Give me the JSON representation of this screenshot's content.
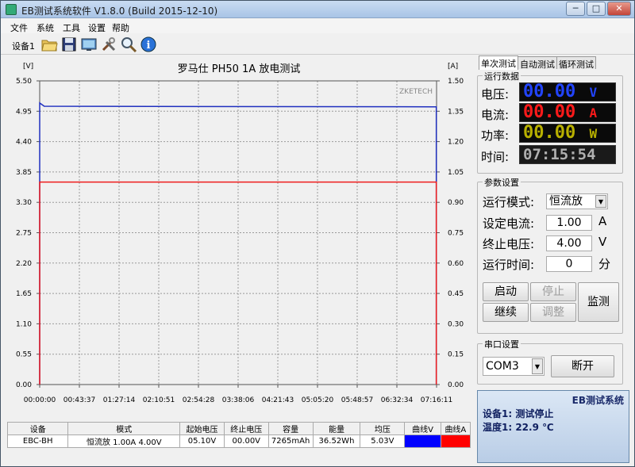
{
  "window": {
    "title": "EB测试系统软件 V1.8.0 (Build 2015-12-10)",
    "minimize": "─",
    "restore": "□",
    "close": "✕"
  },
  "menu": [
    "文件",
    "系统",
    "工具",
    "设置",
    "帮助"
  ],
  "toolbar": {
    "device_label": "设备1",
    "icons": [
      "folder-icon",
      "save-icon",
      "monitor-icon",
      "tools-icon",
      "zoom-icon",
      "info-icon"
    ]
  },
  "chart_data": {
    "type": "line",
    "title": "罗马仕 PH50 1A 放电测试",
    "watermark": "ZKETECH",
    "left_unit": "[V]",
    "right_unit": "[A]",
    "y_left_ticks": [
      "5.50",
      "4.95",
      "4.40",
      "3.85",
      "3.30",
      "2.75",
      "2.20",
      "1.65",
      "1.10",
      "0.55",
      "0.00"
    ],
    "y_right_ticks": [
      "1.50",
      "1.35",
      "1.20",
      "1.05",
      "0.90",
      "0.75",
      "0.60",
      "0.45",
      "0.30",
      "0.15",
      "0.00"
    ],
    "x_ticks": [
      "00:00:00",
      "00:43:37",
      "01:27:14",
      "02:10:51",
      "02:54:28",
      "03:38:06",
      "04:21:43",
      "05:05:20",
      "05:48:57",
      "06:32:34",
      "07:16:11"
    ],
    "ylim_left": [
      0,
      5.5
    ],
    "ylim_right": [
      0,
      1.5
    ],
    "xlim_seconds": [
      0,
      26171
    ],
    "end_seconds": 26154,
    "series": [
      {
        "name": "曲线V",
        "color": "#1f2fbf",
        "axis": "left",
        "points": [
          [
            0,
            5.1
          ],
          [
            300,
            5.04
          ],
          [
            26000,
            5.03
          ],
          [
            26154,
            5.03
          ]
        ]
      },
      {
        "name": "曲线A",
        "color": "#ee1c1c",
        "axis": "right",
        "points": [
          [
            0,
            1.0
          ],
          [
            26154,
            1.0
          ]
        ]
      }
    ]
  },
  "table": {
    "headers": [
      "设备",
      "模式",
      "起始电压",
      "终止电压",
      "容量",
      "能量",
      "均压",
      "曲线V",
      "曲线A"
    ],
    "row": [
      "EBC-BH",
      "恒流放  1.00A  4.00V",
      "05.10V",
      "00.00V",
      "7265mAh",
      "36.52Wh",
      "5.03V",
      "",
      ""
    ],
    "curve_colors": [
      "#0000ff",
      "#ff0000"
    ]
  },
  "tabs": [
    "单次测试",
    "自动测试",
    "循环测试"
  ],
  "run_data": {
    "title": "运行数据",
    "rows": [
      {
        "label": "电压:",
        "value": "00.00",
        "unit": "V",
        "color": "#2244ff"
      },
      {
        "label": "电流:",
        "value": "00.00",
        "unit": "A",
        "color": "#ff1a1a"
      },
      {
        "label": "功率:",
        "value": "00.00",
        "unit": "W",
        "color": "#b8b000"
      },
      {
        "label": "时间:",
        "value": "07:15:54",
        "unit": "",
        "color": "#b0b0b0"
      }
    ]
  },
  "params": {
    "title": "参数设置",
    "mode_label": "运行模式:",
    "mode_value": "恒流放",
    "current_label": "设定电流:",
    "current_value": "1.00",
    "current_unit": "A",
    "voltage_label": "终止电压:",
    "voltage_value": "4.00",
    "voltage_unit": "V",
    "time_label": "运行时间:",
    "time_value": "0",
    "time_unit": "分",
    "buttons": {
      "start": "启动",
      "stop": "停止",
      "continue": "继续",
      "adjust": "调整",
      "monitor": "监测"
    }
  },
  "serial": {
    "title": "串口设置",
    "port": "COM3",
    "disconnect": "断开"
  },
  "status": {
    "title": "EB测试系统",
    "line1": "设备1: 测试停止",
    "line2": "温度1: 22.9 ℃"
  }
}
